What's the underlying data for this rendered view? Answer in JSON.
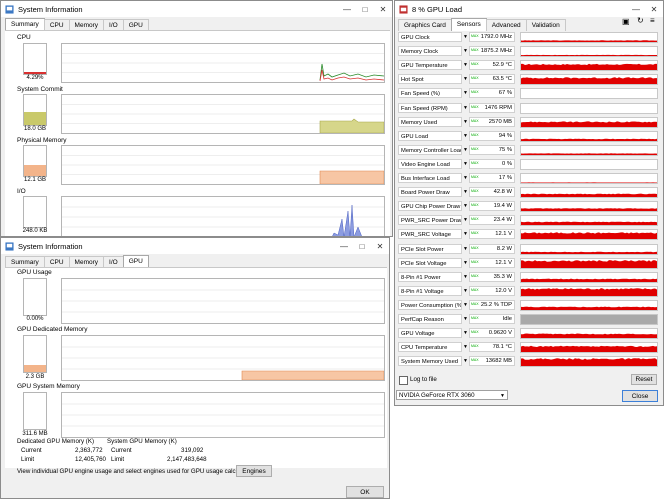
{
  "sysinfo_top": {
    "title": "System Information",
    "tabs": [
      "Summary",
      "CPU",
      "Memory",
      "I/O",
      "GPU"
    ],
    "sections": [
      {
        "label": "CPU",
        "value": "4.29%",
        "fill": 0.04,
        "color": "#d83030"
      },
      {
        "label": "System Commit",
        "value": "18.0 GB",
        "fill": 0.45,
        "color": "#c9c96a"
      },
      {
        "label": "Physical Memory",
        "value": "12.1 GB",
        "fill": 0.38,
        "color": "#f3b48a"
      },
      {
        "label": "I/O",
        "value": "248.0  KB",
        "fill": 0.0,
        "color": "#6b7fd0"
      }
    ]
  },
  "sysinfo_gpu": {
    "title": "System Information",
    "tabs": [
      "Summary",
      "CPU",
      "Memory",
      "I/O",
      "GPU"
    ],
    "sections": [
      {
        "label": "GPU Usage",
        "value": "0.00%",
        "fill": 0.0,
        "color": "#d83030"
      },
      {
        "label": "GPU Dedicated Memory",
        "value": "2.3 GB",
        "fill": 0.19,
        "color": "#f3b48a"
      },
      {
        "label": "GPU System Memory",
        "value": "311.6 MB",
        "fill": 0.0,
        "color": "#c9c96a"
      }
    ],
    "dedicated": {
      "header": "Dedicated GPU Memory (K)",
      "current_label": "Current",
      "current": "2,363,772",
      "limit_label": "Limit",
      "limit": "12,405,760"
    },
    "system": {
      "header": "System GPU Memory (K)",
      "current_label": "Current",
      "current": "319,092",
      "limit_label": "Limit",
      "limit": "2,147,483,648"
    },
    "footer_text": "View individual GPU engine usage and select engines used for GPU usage calculations:",
    "engines_label": "Engines",
    "ok_label": "OK"
  },
  "gpuz": {
    "title": "8 % GPU Load",
    "tabs": [
      "Graphics Card",
      "Sensors",
      "Advanced",
      "Validation"
    ],
    "max_tag": "MAX",
    "sensors": [
      {
        "label": "GPU Clock",
        "value": "1792.0 MHz",
        "level": 0.15
      },
      {
        "label": "Memory Clock",
        "value": "1875.2 MHz",
        "level": 0.1
      },
      {
        "label": "GPU Temperature",
        "value": "52.9 °C",
        "level": 0.55
      },
      {
        "label": "Hot Spot",
        "value": "63.5 °C",
        "level": 0.6
      },
      {
        "label": "Fan Speed (%)",
        "value": "67 %",
        "level": 0.0
      },
      {
        "label": "Fan Speed (RPM)",
        "value": "1476 RPM",
        "level": 0.0
      },
      {
        "label": "Memory Used",
        "value": "2570 MB",
        "level": 0.5
      },
      {
        "label": "GPU Load",
        "value": "94 %",
        "level": 0.2
      },
      {
        "label": "Memory Controller Load",
        "value": "75 %",
        "level": 0.15
      },
      {
        "label": "Video Engine Load",
        "value": "0 %",
        "level": 0.0
      },
      {
        "label": "Bus Interface Load",
        "value": "17 %",
        "level": 0.05
      },
      {
        "label": "Board Power Draw",
        "value": "42.8 W",
        "level": 0.3
      },
      {
        "label": "GPU Chip Power Draw",
        "value": "19.4 W",
        "level": 0.25
      },
      {
        "label": "PWR_SRC Power Draw",
        "value": "23.4 W",
        "level": 0.3
      },
      {
        "label": "PWR_SRC Voltage",
        "value": "12.1 V",
        "level": 0.6
      },
      {
        "label": "PCIe Slot Power",
        "value": "8.2 W",
        "level": 0.2
      },
      {
        "label": "PCIe Slot Voltage",
        "value": "12.1 V",
        "level": 0.7
      },
      {
        "label": "8-Pin #1 Power",
        "value": "35.3 W",
        "level": 0.3
      },
      {
        "label": "8-Pin #1 Voltage",
        "value": "12.0 V",
        "level": 0.7
      },
      {
        "label": "Power Consumption (%)",
        "value": "25.2 % TDP",
        "level": 0.3
      },
      {
        "label": "PerfCap Reason",
        "value": "Idle",
        "level": 1.0
      },
      {
        "label": "GPU Voltage",
        "value": "0.9620 V",
        "level": 0.4
      },
      {
        "label": "CPU Temperature",
        "value": "78.1 °C",
        "level": 0.55
      },
      {
        "label": "System Memory Used",
        "value": "13682 MB",
        "level": 0.7
      }
    ],
    "log_label": "Log to file",
    "reset_label": "Reset",
    "device": "NVIDIA GeForce RTX 3060",
    "close_label": "Close"
  }
}
